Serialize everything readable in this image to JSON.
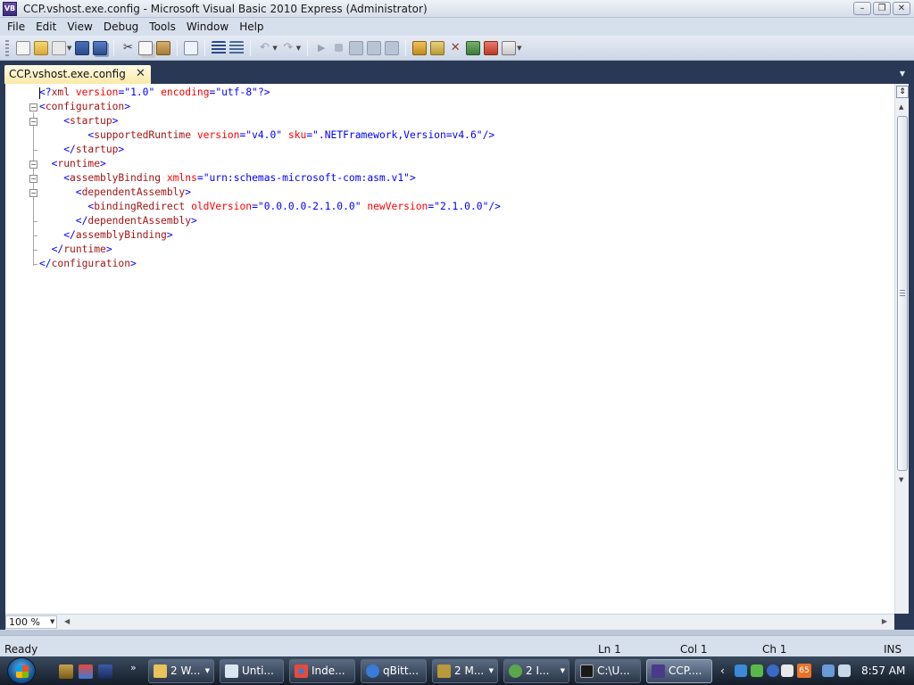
{
  "window": {
    "title": "CCP.vshost.exe.config - Microsoft Visual Basic 2010 Express (Administrator)",
    "app_icon_text": "VB",
    "minimize": "–",
    "restore": "❐",
    "close": "✕"
  },
  "menu": {
    "items": [
      "File",
      "Edit",
      "View",
      "Debug",
      "Tools",
      "Window",
      "Help"
    ]
  },
  "toolbar": {
    "icons": [
      "new-project-icon",
      "open-file-icon",
      "add-item-icon",
      "save-icon",
      "save-all-icon",
      "cut-icon",
      "copy-icon",
      "paste-icon",
      "find-icon",
      "comment-icon",
      "uncomment-icon",
      "undo-icon",
      "redo-icon",
      "start-debugging-icon",
      "stop-debugging-icon",
      "step-into-icon",
      "step-over-icon",
      "step-out-icon",
      "solution-explorer-icon",
      "properties-icon",
      "toolbox-icon",
      "object-browser-icon",
      "error-list-icon",
      "extension-manager-icon"
    ]
  },
  "tab": {
    "label": "CCP.vshost.exe.config",
    "close": "✕"
  },
  "editor": {
    "lines": [
      [
        {
          "t": "<?",
          "c": "blue"
        },
        {
          "t": "xml",
          "c": "maroon"
        },
        {
          "t": " ",
          "c": "blue"
        },
        {
          "t": "version",
          "c": "red"
        },
        {
          "t": "=",
          "c": "blue"
        },
        {
          "t": "\"",
          "c": "blue"
        },
        {
          "t": "1.0",
          "c": "blue"
        },
        {
          "t": "\"",
          "c": "blue"
        },
        {
          "t": " ",
          "c": "blue"
        },
        {
          "t": "encoding",
          "c": "red"
        },
        {
          "t": "=",
          "c": "blue"
        },
        {
          "t": "\"utf-8\"",
          "c": "blue"
        },
        {
          "t": "?>",
          "c": "blue"
        }
      ],
      [
        {
          "t": "<",
          "c": "blue"
        },
        {
          "t": "configuration",
          "c": "maroon"
        },
        {
          "t": ">",
          "c": "blue"
        }
      ],
      [
        {
          "t": "    <",
          "c": "blue"
        },
        {
          "t": "startup",
          "c": "maroon"
        },
        {
          "t": ">",
          "c": "blue"
        }
      ],
      [
        {
          "t": "        <",
          "c": "blue"
        },
        {
          "t": "supportedRuntime",
          "c": "maroon"
        },
        {
          "t": " ",
          "c": "blue"
        },
        {
          "t": "version",
          "c": "red"
        },
        {
          "t": "=",
          "c": "blue"
        },
        {
          "t": "\"v4.0\"",
          "c": "blue"
        },
        {
          "t": " ",
          "c": "blue"
        },
        {
          "t": "sku",
          "c": "red"
        },
        {
          "t": "=",
          "c": "blue"
        },
        {
          "t": "\".NETFramework,Version=v4.6\"",
          "c": "blue"
        },
        {
          "t": "/>",
          "c": "blue"
        }
      ],
      [
        {
          "t": "    </",
          "c": "blue"
        },
        {
          "t": "startup",
          "c": "maroon"
        },
        {
          "t": ">",
          "c": "blue"
        }
      ],
      [
        {
          "t": "  <",
          "c": "blue"
        },
        {
          "t": "runtime",
          "c": "maroon"
        },
        {
          "t": ">",
          "c": "blue"
        }
      ],
      [
        {
          "t": "    <",
          "c": "blue"
        },
        {
          "t": "assemblyBinding",
          "c": "maroon"
        },
        {
          "t": " ",
          "c": "blue"
        },
        {
          "t": "xmlns",
          "c": "red"
        },
        {
          "t": "=",
          "c": "blue"
        },
        {
          "t": "\"urn:schemas-microsoft-com:asm.v1\"",
          "c": "blue"
        },
        {
          "t": ">",
          "c": "blue"
        }
      ],
      [
        {
          "t": "      <",
          "c": "blue"
        },
        {
          "t": "dependentAssembly",
          "c": "maroon"
        },
        {
          "t": ">",
          "c": "blue"
        }
      ],
      [
        {
          "t": "        <",
          "c": "blue"
        },
        {
          "t": "bindingRedirect",
          "c": "maroon"
        },
        {
          "t": " ",
          "c": "blue"
        },
        {
          "t": "oldVersion",
          "c": "red"
        },
        {
          "t": "=",
          "c": "blue"
        },
        {
          "t": "\"0.0.0.0-2.1.0.0\"",
          "c": "blue"
        },
        {
          "t": " ",
          "c": "blue"
        },
        {
          "t": "newVersion",
          "c": "red"
        },
        {
          "t": "=",
          "c": "blue"
        },
        {
          "t": "\"2.1.0.0\"",
          "c": "blue"
        },
        {
          "t": "/>",
          "c": "blue"
        }
      ],
      [
        {
          "t": "      </",
          "c": "blue"
        },
        {
          "t": "dependentAssembly",
          "c": "maroon"
        },
        {
          "t": ">",
          "c": "blue"
        }
      ],
      [
        {
          "t": "    </",
          "c": "blue"
        },
        {
          "t": "assemblyBinding",
          "c": "maroon"
        },
        {
          "t": ">",
          "c": "blue"
        }
      ],
      [
        {
          "t": "  </",
          "c": "blue"
        },
        {
          "t": "runtime",
          "c": "maroon"
        },
        {
          "t": ">",
          "c": "blue"
        }
      ],
      [
        {
          "t": "</",
          "c": "blue"
        },
        {
          "t": "configuration",
          "c": "maroon"
        },
        {
          "t": ">",
          "c": "blue"
        }
      ]
    ],
    "zoom": "100 %"
  },
  "colors": {
    "blue": "#0000ff",
    "maroon": "#a31515",
    "red": "#ff0000",
    "chrome": "#293955"
  },
  "status": {
    "ready": "Ready",
    "ln": "Ln 1",
    "col": "Col 1",
    "ch": "Ch 1",
    "mode": "INS"
  },
  "taskbar": {
    "quicklaunch_more": "»",
    "buttons": [
      {
        "label": "2 W...",
        "icon": "folder-icon",
        "color": "#e8c25a"
      },
      {
        "label": "Unti...",
        "icon": "notepad-icon",
        "color": "#d8e6f2"
      },
      {
        "label": "Inde...",
        "icon": "chrome-icon",
        "color": "#e84a3a"
      },
      {
        "label": "qBitt...",
        "icon": "qbittorrent-icon",
        "color": "#3a7ad8"
      },
      {
        "label": "2 M...",
        "icon": "vb-project-icon",
        "color": "#b89a3a"
      },
      {
        "label": "2 I...",
        "icon": "globe-icon",
        "color": "#5aa84a"
      },
      {
        "label": "C:\\U...",
        "icon": "7zip-icon",
        "color": "#1a1a1a"
      },
      {
        "label": "CCP....",
        "icon": "visual-basic-icon",
        "color": "#4a3a8a"
      }
    ],
    "tray_badge": "65",
    "clock": "8:57 AM"
  }
}
